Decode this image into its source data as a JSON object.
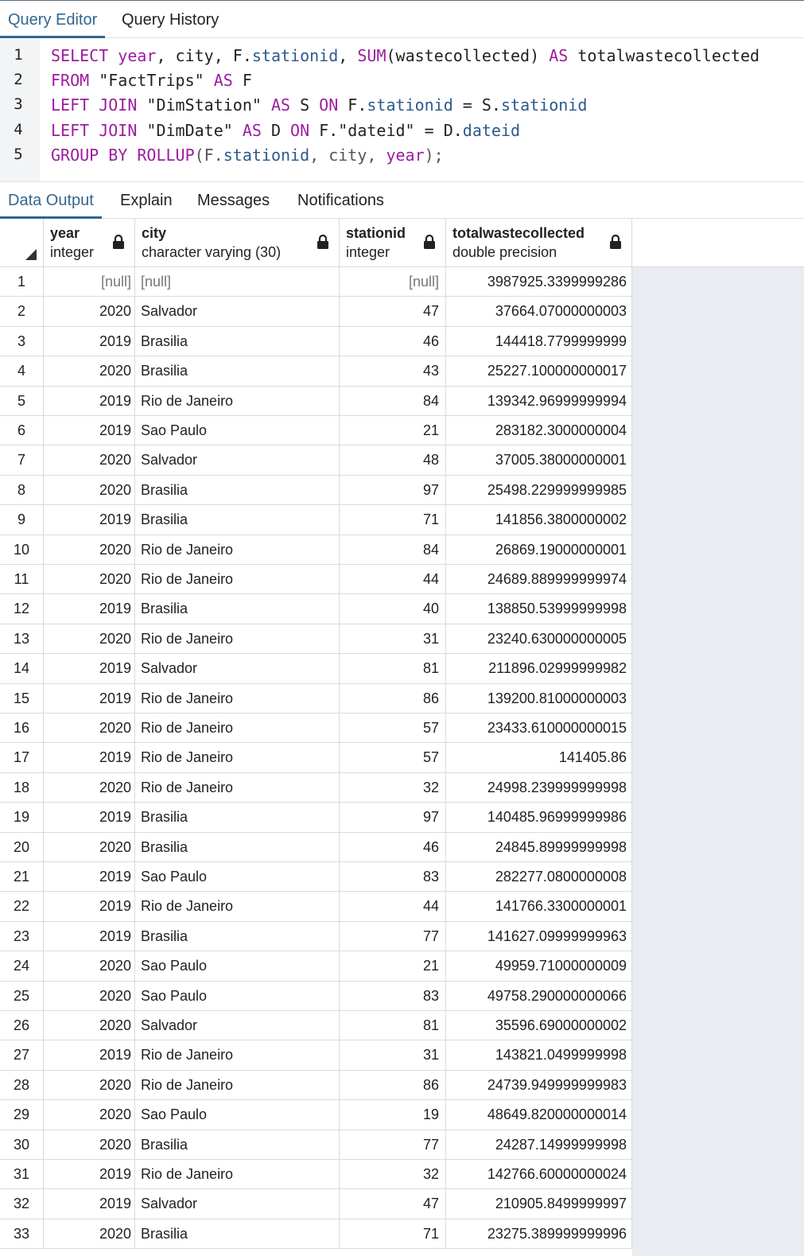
{
  "editor_tabs": [
    "Query Editor",
    "Query History"
  ],
  "line_numbers": [
    "1",
    "2",
    "3",
    "4",
    "5"
  ],
  "sql": {
    "l1": [
      "SELECT",
      "year",
      ", city, F.",
      "stationid",
      ", ",
      "SUM",
      "(wastecollected) ",
      "AS",
      " totalwastecollected"
    ],
    "l2": [
      "FROM",
      " \"FactTrips\" ",
      "AS",
      " F"
    ],
    "l3": [
      "LEFT JOIN",
      " \"DimStation\" ",
      "AS",
      " S ",
      "ON",
      " F.",
      "stationid",
      " = S.",
      "stationid"
    ],
    "l4": [
      "LEFT JOIN",
      " \"DimDate\" ",
      "AS",
      " D ",
      "ON",
      " F.\"dateid\" = D.",
      "dateid"
    ],
    "l5": [
      "GROUP BY",
      " ",
      "ROLLUP",
      "(F.",
      "stationid",
      ", city, ",
      "year",
      ");"
    ]
  },
  "output_tabs": [
    "Data Output",
    "Explain",
    "Messages",
    "Notifications"
  ],
  "columns": [
    {
      "name": "year",
      "type": "integer"
    },
    {
      "name": "city",
      "type": "character varying (30)"
    },
    {
      "name": "stationid",
      "type": "integer"
    },
    {
      "name": "totalwastecollected",
      "type": "double precision"
    }
  ],
  "rows": [
    [
      "1",
      "[null]",
      "[null]",
      "[null]",
      "3987925.3399999286"
    ],
    [
      "2",
      "2020",
      "Salvador",
      "47",
      "37664.07000000003"
    ],
    [
      "3",
      "2019",
      "Brasilia",
      "46",
      "144418.7799999999"
    ],
    [
      "4",
      "2020",
      "Brasilia",
      "43",
      "25227.100000000017"
    ],
    [
      "5",
      "2019",
      "Rio de Janeiro",
      "84",
      "139342.96999999994"
    ],
    [
      "6",
      "2019",
      "Sao Paulo",
      "21",
      "283182.3000000004"
    ],
    [
      "7",
      "2020",
      "Salvador",
      "48",
      "37005.38000000001"
    ],
    [
      "8",
      "2020",
      "Brasilia",
      "97",
      "25498.229999999985"
    ],
    [
      "9",
      "2019",
      "Brasilia",
      "71",
      "141856.3800000002"
    ],
    [
      "10",
      "2020",
      "Rio de Janeiro",
      "84",
      "26869.19000000001"
    ],
    [
      "11",
      "2020",
      "Rio de Janeiro",
      "44",
      "24689.889999999974"
    ],
    [
      "12",
      "2019",
      "Brasilia",
      "40",
      "138850.53999999998"
    ],
    [
      "13",
      "2020",
      "Rio de Janeiro",
      "31",
      "23240.630000000005"
    ],
    [
      "14",
      "2019",
      "Salvador",
      "81",
      "211896.02999999982"
    ],
    [
      "15",
      "2019",
      "Rio de Janeiro",
      "86",
      "139200.81000000003"
    ],
    [
      "16",
      "2020",
      "Rio de Janeiro",
      "57",
      "23433.610000000015"
    ],
    [
      "17",
      "2019",
      "Rio de Janeiro",
      "57",
      "141405.86"
    ],
    [
      "18",
      "2020",
      "Rio de Janeiro",
      "32",
      "24998.239999999998"
    ],
    [
      "19",
      "2019",
      "Brasilia",
      "97",
      "140485.96999999986"
    ],
    [
      "20",
      "2020",
      "Brasilia",
      "46",
      "24845.89999999998"
    ],
    [
      "21",
      "2019",
      "Sao Paulo",
      "83",
      "282277.0800000008"
    ],
    [
      "22",
      "2019",
      "Rio de Janeiro",
      "44",
      "141766.3300000001"
    ],
    [
      "23",
      "2019",
      "Brasilia",
      "77",
      "141627.09999999963"
    ],
    [
      "24",
      "2020",
      "Sao Paulo",
      "21",
      "49959.71000000009"
    ],
    [
      "25",
      "2020",
      "Sao Paulo",
      "83",
      "49758.290000000066"
    ],
    [
      "26",
      "2020",
      "Salvador",
      "81",
      "35596.69000000002"
    ],
    [
      "27",
      "2019",
      "Rio de Janeiro",
      "31",
      "143821.0499999998"
    ],
    [
      "28",
      "2020",
      "Rio de Janeiro",
      "86",
      "24739.949999999983"
    ],
    [
      "29",
      "2020",
      "Sao Paulo",
      "19",
      "48649.820000000014"
    ],
    [
      "30",
      "2020",
      "Brasilia",
      "77",
      "24287.14999999998"
    ],
    [
      "31",
      "2019",
      "Rio de Janeiro",
      "32",
      "142766.60000000024"
    ],
    [
      "32",
      "2019",
      "Salvador",
      "47",
      "210905.8499999997"
    ],
    [
      "33",
      "2020",
      "Brasilia",
      "71",
      "23275.389999999996"
    ]
  ],
  "colors": {
    "accent": "#326690",
    "keyword": "#9c1d9f",
    "identifier": "#2c5a8a"
  },
  "icons": {
    "column_lock": "lock-icon",
    "corner": "sort-corner-icon"
  }
}
